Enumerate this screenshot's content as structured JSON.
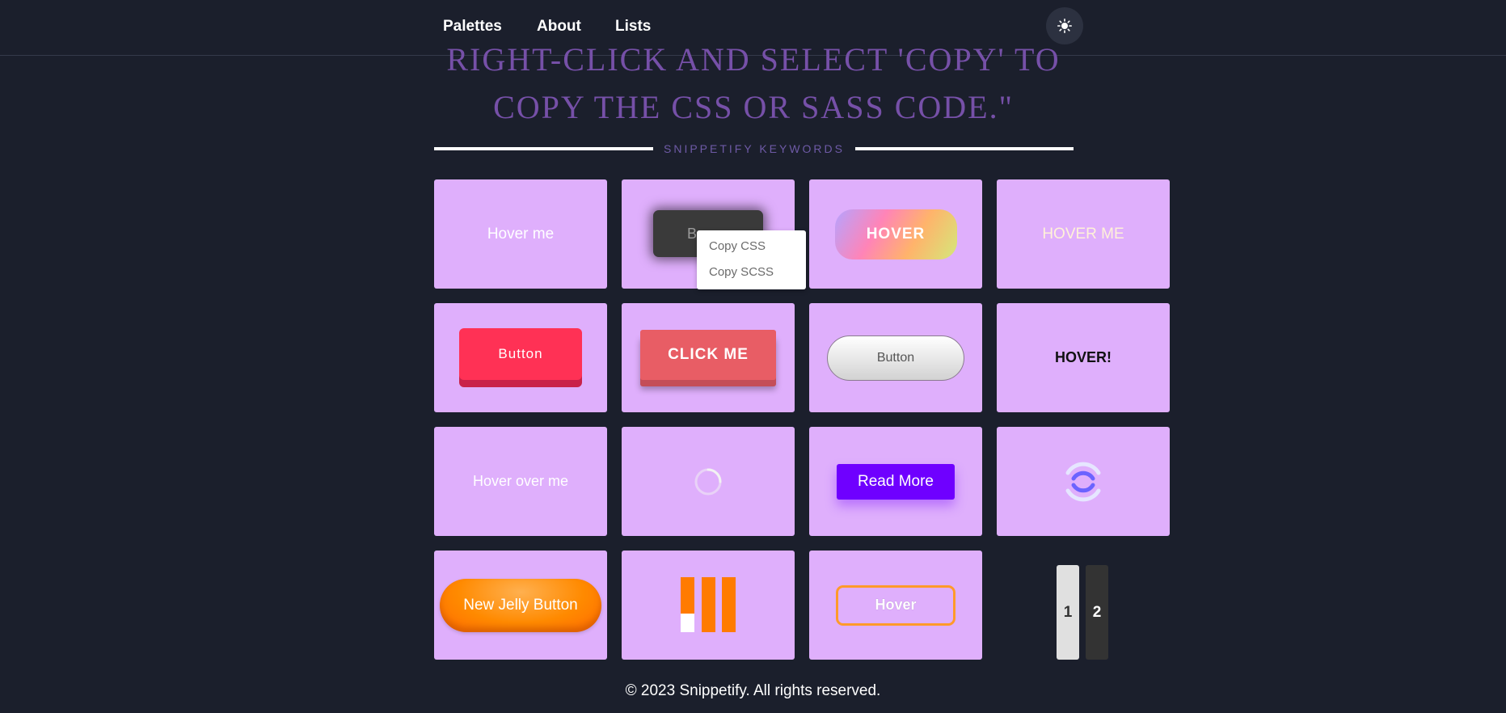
{
  "nav": {
    "palettes": "Palettes",
    "about": "About",
    "lists": "Lists",
    "theme_icon": "sun-icon"
  },
  "headline": {
    "line1": "RIGHT-CLICK AND SELECT 'COPY' TO",
    "line2": "COPY THE CSS OR SASS CODE.\""
  },
  "keywords_label": "SNIPPETIFY KEYWORDS",
  "cards": {
    "c1": "Hover me",
    "c2": "Be",
    "c3": "HOVER",
    "c4": "HOVER ME",
    "c5": "Button",
    "c6": "CLICK ME",
    "c7": "Button",
    "c8": "HOVER!",
    "c9": "Hover over me",
    "c11": "Read More",
    "c13": "New Jelly Button",
    "c15": "Hover"
  },
  "context_menu": {
    "copy_css": "Copy CSS",
    "copy_scss": "Copy SCSS"
  },
  "pagination": {
    "page1": "1",
    "page2": "2",
    "current": "1"
  },
  "footer": "© 2023 Snippetify. All rights reserved.",
  "colors": {
    "background": "#1b1f2c",
    "card": "#dfaffc",
    "accent_purple": "#7650a8",
    "orange": "#ff7b00",
    "red": "#ff3155"
  }
}
